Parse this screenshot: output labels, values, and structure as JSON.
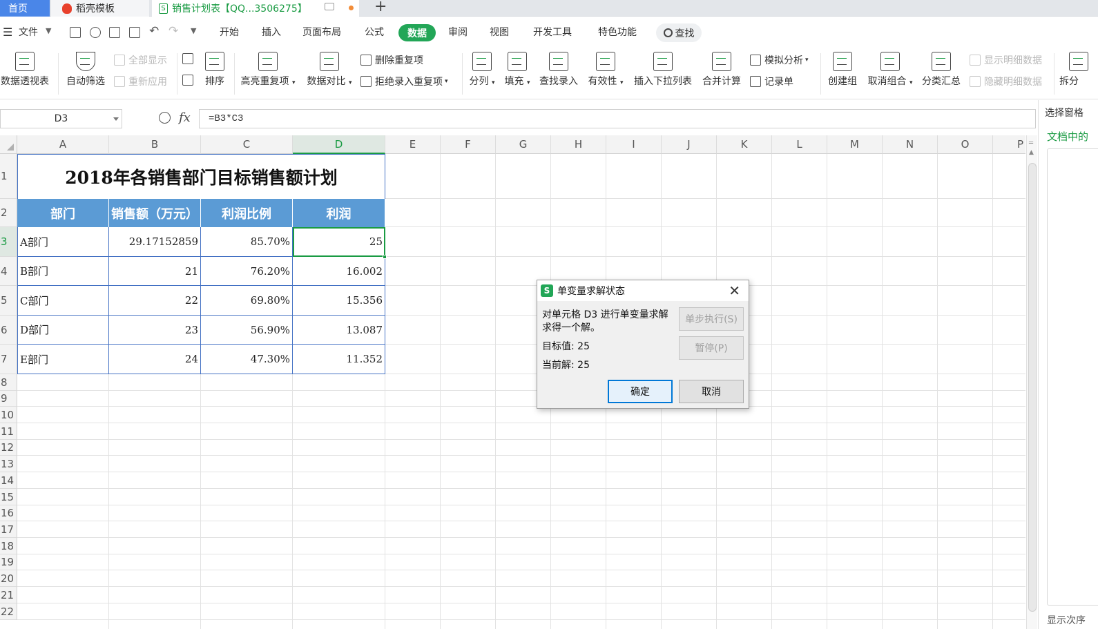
{
  "tabs": {
    "home": "首页",
    "draft": "稻壳模板",
    "sheet": "销售计划表【QQ...3506275】"
  },
  "menubar": {
    "file": "文件",
    "items": [
      "开始",
      "插入",
      "页面布局",
      "公式",
      "数据",
      "审阅",
      "视图",
      "开发工具",
      "特色功能"
    ],
    "active": "数据",
    "search": "查找"
  },
  "ribbon": {
    "pivot": "数据透视表",
    "autofilter": "自动筛选",
    "show_all": "全部显示",
    "reapply": "重新应用",
    "sort": "排序",
    "highlight_dup": "高亮重复项",
    "compare": "数据对比",
    "delete_dup": "删除重复项",
    "reject_dup": "拒绝录入重复项",
    "split": "分列",
    "fill": "填充",
    "lookup_entry": "查找录入",
    "validity": "有效性",
    "insert_dropdown": "插入下拉列表",
    "consolidate": "合并计算",
    "simulation": "模拟分析",
    "record_form": "记录单",
    "create_group": "创建组",
    "ungroup": "取消组合",
    "subtotal": "分类汇总",
    "show_detail": "显示明细数据",
    "hide_detail": "隐藏明细数据",
    "split_table": "拆分"
  },
  "formula_bar": {
    "name_box": "D3",
    "fx": "fx",
    "formula": "=B3*C3"
  },
  "sheet": {
    "columns": [
      "A",
      "B",
      "C",
      "D",
      "E",
      "F",
      "G",
      "H",
      "I",
      "J",
      "K",
      "L",
      "M",
      "N",
      "O",
      "P"
    ],
    "rows": [
      "1",
      "2",
      "3",
      "4",
      "5",
      "6",
      "7",
      "8",
      "9",
      "10",
      "11",
      "12",
      "13",
      "14",
      "15",
      "16",
      "17",
      "18",
      "19",
      "20",
      "21",
      "22"
    ],
    "selected_column": "D",
    "selected_row": "3",
    "title": "2018年各销售部门目标销售额计划",
    "headers": [
      "部门",
      "销售额（万元）",
      "利润比例",
      "利润"
    ],
    "data": [
      [
        "A部门",
        "29.17152859",
        "85.70%",
        "25"
      ],
      [
        "B部门",
        "21",
        "76.20%",
        "16.002"
      ],
      [
        "C部门",
        "22",
        "69.80%",
        "15.356"
      ],
      [
        "D部门",
        "23",
        "56.90%",
        "13.087"
      ],
      [
        "E部门",
        "24",
        "47.30%",
        "11.352"
      ]
    ]
  },
  "side_panel": {
    "title": "选择窗格",
    "link": "文档中的",
    "bottom": "显示次序"
  },
  "dialog": {
    "title": "单变量求解状态",
    "message_line1": "对单元格 D3 进行单变量求解",
    "message_line2": "求得一个解。",
    "target_label": "目标值:  25",
    "current_label": "当前解:  25",
    "step_button": "单步执行(S)",
    "pause_button": "暂停(P)",
    "ok_button": "确定",
    "cancel_button": "取消"
  }
}
